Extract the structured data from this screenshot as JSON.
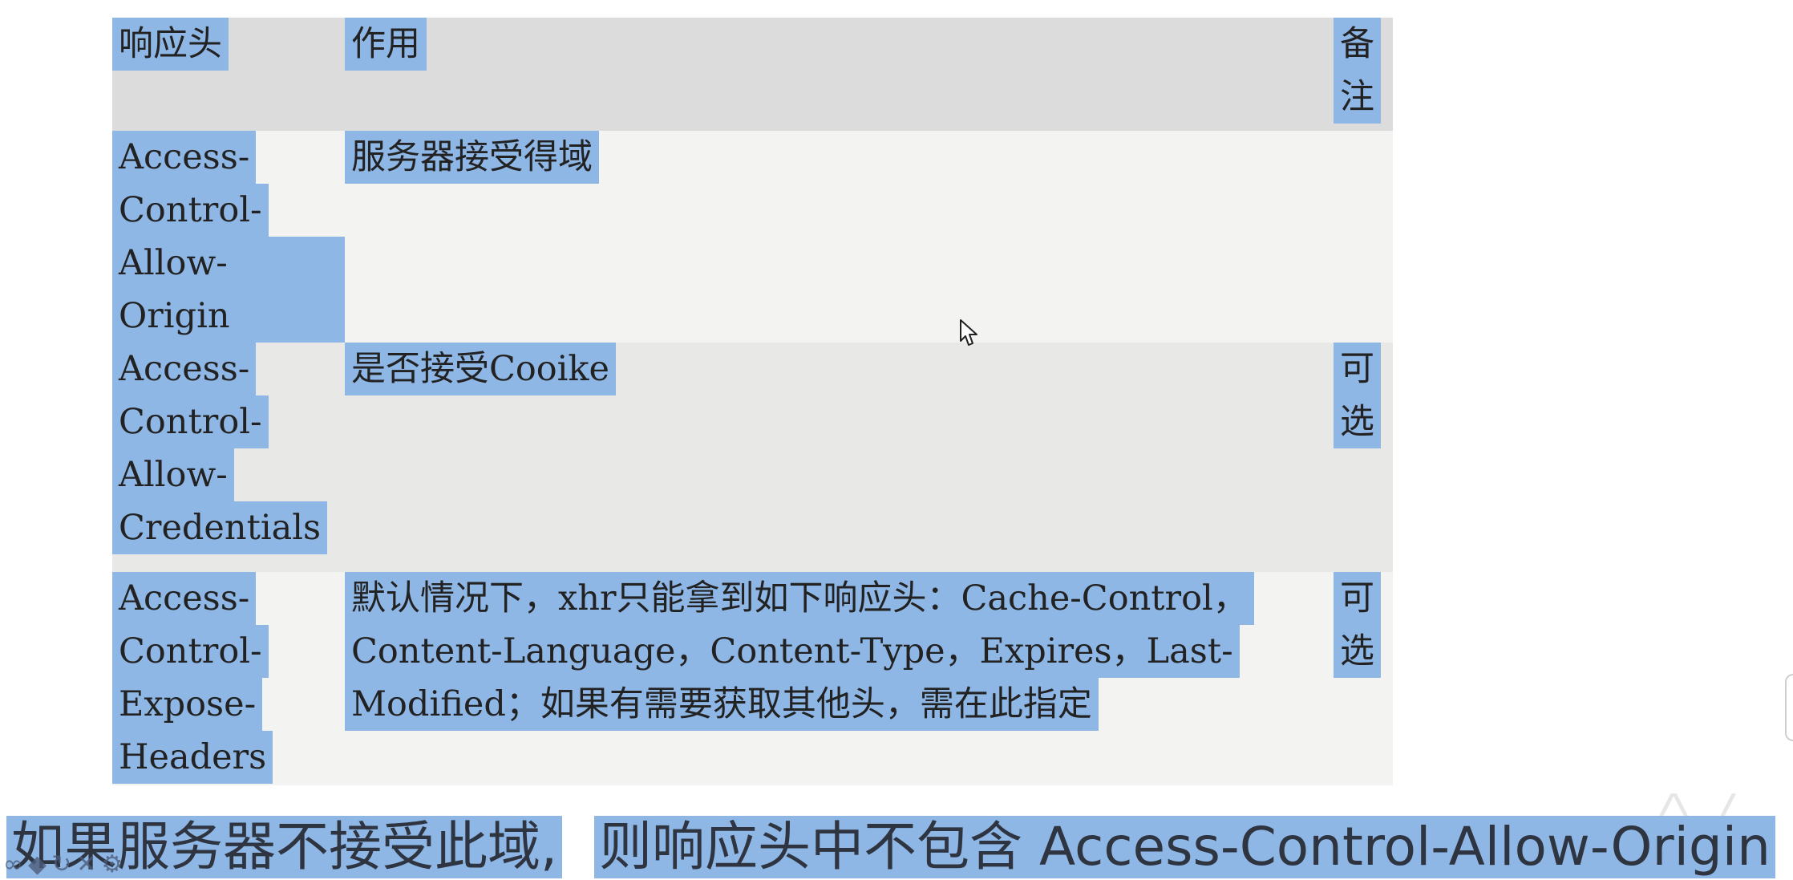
{
  "table": {
    "headers": {
      "header": "响应头",
      "purpose": "作用",
      "note_line1": "备",
      "note_line2": "注"
    },
    "rows": [
      {
        "header_lines": [
          "Access-",
          "Control-",
          "Allow-Origin"
        ],
        "description_lines": [
          "服务器接受得域"
        ],
        "note_lines": []
      },
      {
        "header_lines": [
          "Access-",
          "Control-",
          "Allow-",
          "Credentials"
        ],
        "description_lines": [
          "是否接受Cooike"
        ],
        "note_lines": [
          "可",
          "选"
        ]
      },
      {
        "header_lines": [
          "Access-",
          "Control-",
          "Expose-",
          "Headers"
        ],
        "description_lines": [
          "默认情况下，xhr只能拿到如下响应头：Cache-Control，",
          "Content-Language，Content-Type，Expires，Last-",
          "Modified；如果有需要获取其他头，需在此指定"
        ],
        "note_lines": [
          "可",
          "选"
        ]
      }
    ]
  },
  "caption": {
    "part1": "如果服务器不接受此域,",
    "part2": "则响应头中不包含 Access-Control-Allow-Origin"
  },
  "colors": {
    "selection": "#8fb7e6",
    "header_bg": "#dcdcdc",
    "row_light": "#f3f3f1",
    "row_dark": "#e8e8e6"
  },
  "icons": {
    "cursor": "mouse-pointer-icon",
    "player_controls": [
      "infinity-icon",
      "diamond-icon",
      "refresh-icon",
      "close-icon",
      "settings-icon"
    ]
  }
}
